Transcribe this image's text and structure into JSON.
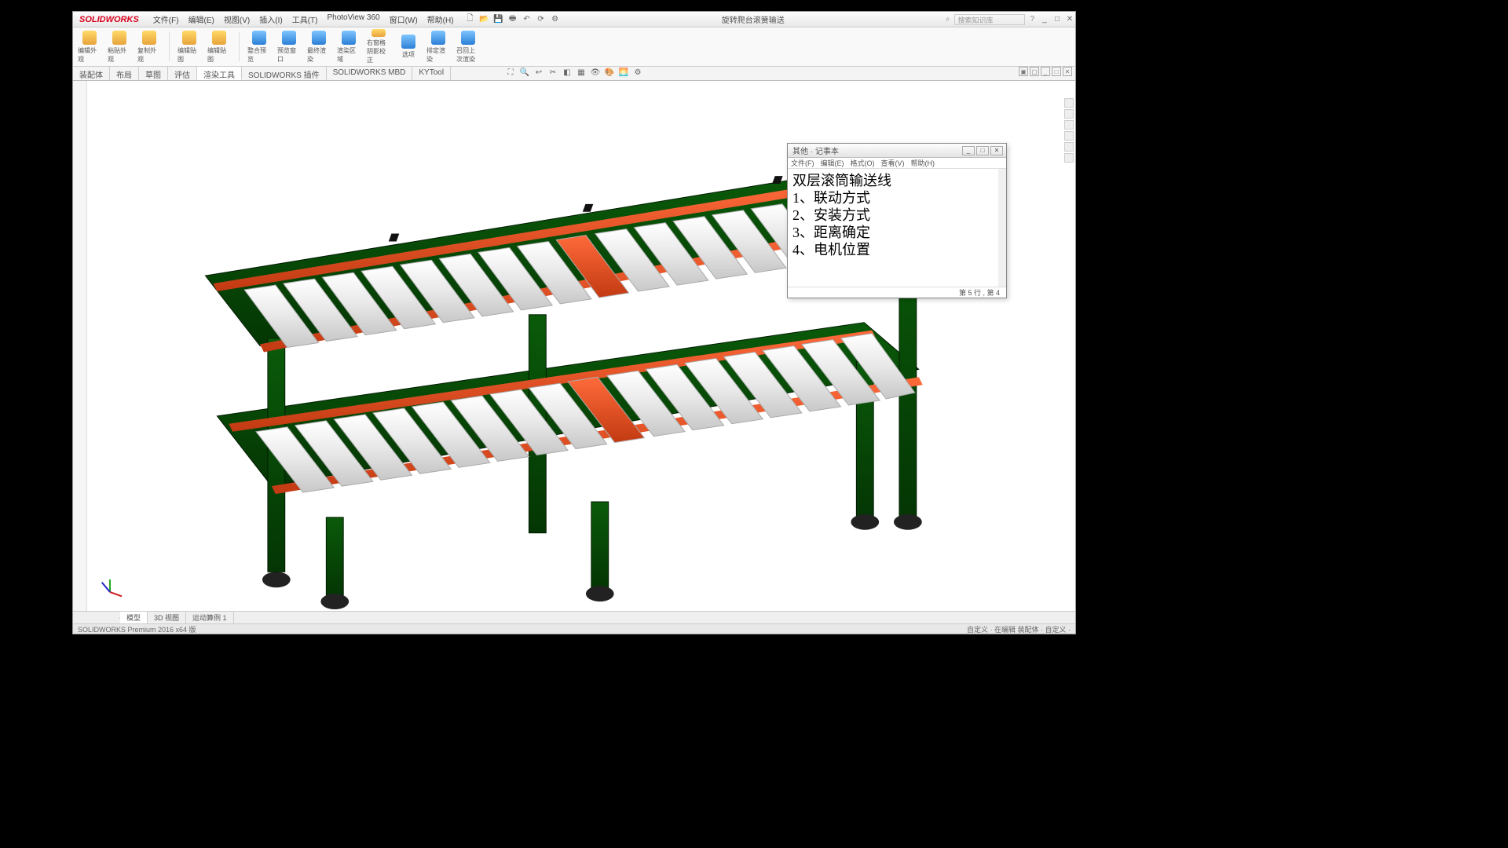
{
  "app": {
    "brand": "SOLIDWORKS",
    "title": "旋转爬台滚簧输送"
  },
  "menu": {
    "file": "文件(F)",
    "edit": "编辑(E)",
    "view": "视图(V)",
    "insert": "插入(I)",
    "tools": "工具(T)",
    "photoview": "PhotoView 360",
    "window": "窗口(W)",
    "help": "帮助(H)"
  },
  "search": {
    "placeholder": "搜索知识库"
  },
  "ribbon": {
    "b0": "编辑外观",
    "b1": "粘贴外观",
    "b2": "复制外观",
    "b3": "编辑贴图",
    "b4": "编辑贴图",
    "b5": "整合预览",
    "b6": "预览窗口",
    "b7": "最终渲染",
    "b8": "渲染区域",
    "b9": "右窗格阴影校正",
    "b10": "选项",
    "b11": "排定渲染",
    "b12": "召回上次渲染"
  },
  "tabs": {
    "t0": "装配体",
    "t1": "布局",
    "t2": "草图",
    "t3": "评估",
    "t4": "渲染工具",
    "t5": "SOLIDWORKS 插件",
    "t6": "SOLIDWORKS MBD",
    "t7": "KYTool"
  },
  "bottom_tabs": {
    "bt0": "模型",
    "bt1": "3D 视图",
    "bt2": "运动算例 1"
  },
  "status": {
    "left": "SOLIDWORKS Premium 2016 x64 版",
    "right": "自定义 · 在编辑 装配体 · 自定义 ·"
  },
  "notepad": {
    "title": "其他 · 记事本",
    "menu": {
      "file": "文件(F)",
      "edit": "编辑(E)",
      "format": "格式(O)",
      "view": "查看(V)",
      "help": "帮助(H)"
    },
    "lines": {
      "l0": "双层滚筒输送线",
      "l1": "1、联动方式",
      "l2": "2、安装方式",
      "l3": "3、距离确定",
      "l4": "4、电机位置"
    },
    "status": "第 5 行 , 第 4"
  }
}
